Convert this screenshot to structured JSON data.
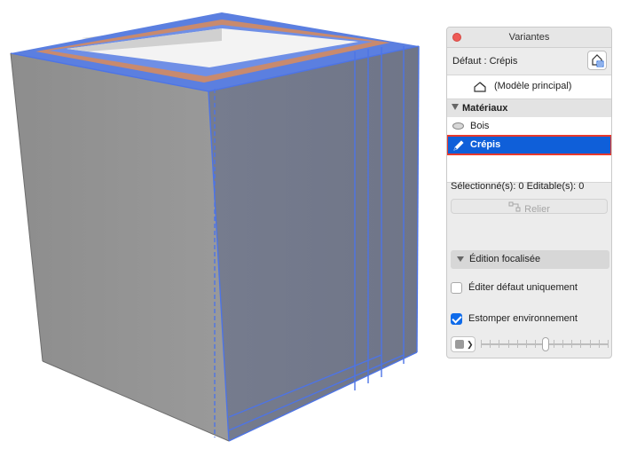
{
  "panel": {
    "title": "Variantes",
    "default_label": "Défaut : Crépis",
    "model_label": "(Modèle principal)",
    "group_label": "Matériaux",
    "items": [
      {
        "label": "Bois",
        "icon": "ellipse-icon"
      },
      {
        "label": "Crépis",
        "icon": "pencil-icon",
        "selected": true
      }
    ],
    "stats": "Sélectionné(s): 0 Editable(s): 0",
    "relier_label": "Relier",
    "focus_label": "Édition focalisée",
    "edit_default_only": {
      "label": "Éditer défaut uniquement",
      "checked": false
    },
    "fade_environment": {
      "label": "Estomper environnement",
      "checked": true
    },
    "fade_level": 0.51
  },
  "colors": {
    "selection": "#0f5fd9",
    "highlight_outline": "#e8392c",
    "wall_selection": "#5b7fe0",
    "cap_edge": "#c88a6e"
  }
}
